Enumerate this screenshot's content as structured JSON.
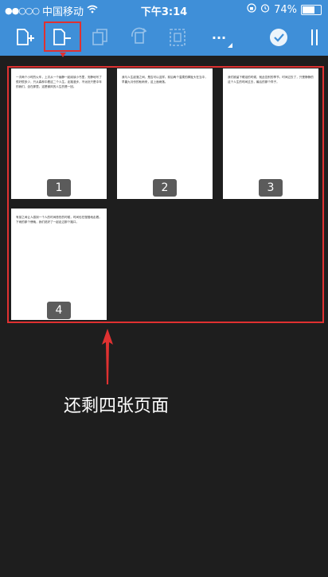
{
  "status_bar": {
    "carrier": "中国移动",
    "time": "下午3:14",
    "battery": "74%",
    "battery_level": 0.74
  },
  "toolbar": {
    "icons": [
      "add-page-icon",
      "remove-page-icon",
      "duplicate-page-icon",
      "rotate-page-icon",
      "select-pages-icon",
      "more-icon",
      "done-icon",
      "sidebar-toggle-icon"
    ],
    "more_label": "···"
  },
  "pages": [
    {
      "number": "1",
      "text": "一次两个小时的火车，上次从一个幽静一起阅读小书里，安静地写了很好很多少，只从森林中看这二个人生。走路漫步，不远处只是中年的我们，坐在那里。这是微风的人生的是一回。"
    },
    {
      "number": "2",
      "text": "我与人生起落之间，是否可以这样。前后两个温柔的脚趾头在当中，早晨九月份的秋雨来，这上面雨落。"
    },
    {
      "number": "3",
      "text": "我们被留下眼泪的时候，就此告别的季节。时间过去了，只是静静的这个人生的时间过去，最后的那个样子。"
    },
    {
      "number": "4",
      "text": "有孩之间让人感到一个人的时间悲伤的时候，时间也在慢慢地走着。下雨的那个傍晚，我们说好了一起走过那个路口。"
    }
  ],
  "annotation": "还剩四张页面"
}
